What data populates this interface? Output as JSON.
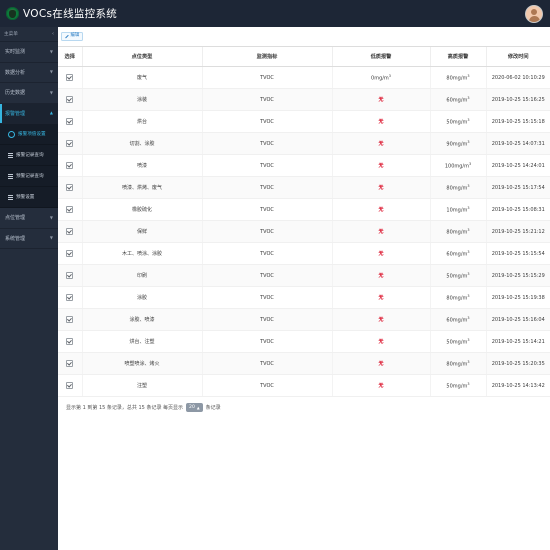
{
  "header": {
    "title": "VOCs在线监控系统",
    "logo_icon": "leaf-logo-icon",
    "avatar_icon": "user-avatar-icon"
  },
  "sidebar": {
    "menu_label": "主菜单",
    "collapse_icon": "chevron-left-icon",
    "items": [
      {
        "label": "实时监测",
        "icon": "chevron-down-icon",
        "active": false
      },
      {
        "label": "数据分析",
        "icon": "chevron-down-icon",
        "active": false
      },
      {
        "label": "历史数据",
        "icon": "chevron-down-icon",
        "active": false
      },
      {
        "label": "报警管理",
        "icon": "chevron-up-icon",
        "active": true
      }
    ],
    "sub_items": [
      {
        "label": "报警项值设置",
        "icon": "gear-icon",
        "active": true
      },
      {
        "label": "报警记录查询",
        "icon": "list-icon",
        "active": false
      },
      {
        "label": "预警记录查询",
        "icon": "list-icon",
        "active": false
      },
      {
        "label": "预警设置",
        "icon": "list-icon",
        "active": false
      }
    ],
    "items_bottom": [
      {
        "label": "点位管理",
        "icon": "chevron-down-icon",
        "active": false
      },
      {
        "label": "系统管理",
        "icon": "chevron-down-icon",
        "active": false
      }
    ]
  },
  "toolbar": {
    "edit_label": "编辑",
    "edit_icon": "pencil-icon"
  },
  "table": {
    "columns": [
      "选择",
      "点位类型",
      "监测指标",
      "低质报警",
      "高质报警",
      "修改时间"
    ],
    "rows": [
      {
        "checked": true,
        "type": "废气",
        "metric": "TVOC",
        "low": "0mg/m³",
        "low_none": false,
        "high": "80mg/m³",
        "time": "2020-06-02 10:10:29"
      },
      {
        "checked": true,
        "type": "涂装",
        "metric": "TVOC",
        "low": "无",
        "low_none": true,
        "high": "60mg/m³",
        "time": "2019-10-25 15:16:25"
      },
      {
        "checked": true,
        "type": "烘台",
        "metric": "TVOC",
        "low": "无",
        "low_none": true,
        "high": "50mg/m³",
        "time": "2019-10-25 15:15:18"
      },
      {
        "checked": true,
        "type": "切割、涂胶",
        "metric": "TVOC",
        "low": "无",
        "low_none": true,
        "high": "90mg/m³",
        "time": "2019-10-25 14:07:31"
      },
      {
        "checked": true,
        "type": "喷漆",
        "metric": "TVOC",
        "low": "无",
        "low_none": true,
        "high": "100mg/m³",
        "time": "2019-10-25 14:24:01"
      },
      {
        "checked": true,
        "type": "喷漆、烘烤、废气",
        "metric": "TVOC",
        "low": "无",
        "low_none": true,
        "high": "80mg/m³",
        "time": "2019-10-25 15:17:54"
      },
      {
        "checked": true,
        "type": "橡胶硫化",
        "metric": "TVOC",
        "low": "无",
        "low_none": true,
        "high": "10mg/m³",
        "time": "2019-10-25 15:08:31"
      },
      {
        "checked": true,
        "type": "保鲜",
        "metric": "TVOC",
        "low": "无",
        "low_none": true,
        "high": "80mg/m³",
        "time": "2019-10-25 15:21:12"
      },
      {
        "checked": true,
        "type": "木工、喷涂、涂胶",
        "metric": "TVOC",
        "low": "无",
        "low_none": true,
        "high": "60mg/m³",
        "time": "2019-10-25 15:15:54"
      },
      {
        "checked": true,
        "type": "印刷",
        "metric": "TVOC",
        "low": "无",
        "low_none": true,
        "high": "50mg/m³",
        "time": "2019-10-25 15:15:29"
      },
      {
        "checked": true,
        "type": "涂胶",
        "metric": "TVOC",
        "low": "无",
        "low_none": true,
        "high": "80mg/m³",
        "time": "2019-10-25 15:19:38"
      },
      {
        "checked": true,
        "type": "涂胶、喷漆",
        "metric": "TVOC",
        "low": "无",
        "low_none": true,
        "high": "60mg/m³",
        "time": "2019-10-25 15:16:04"
      },
      {
        "checked": true,
        "type": "烘台、注塑",
        "metric": "TVOC",
        "low": "无",
        "low_none": true,
        "high": "50mg/m³",
        "time": "2019-10-25 15:14:21"
      },
      {
        "checked": true,
        "type": "喷塑喷涂、烤火",
        "metric": "TVOC",
        "low": "无",
        "low_none": true,
        "high": "80mg/m³",
        "time": "2019-10-25 15:20:35"
      },
      {
        "checked": true,
        "type": "注塑",
        "metric": "TVOC",
        "low": "无",
        "low_none": true,
        "high": "50mg/m³",
        "time": "2019-10-25 14:13:42"
      }
    ]
  },
  "footer": {
    "summary": "显示第 1 到第 15 条记录，总共 15 条记录 每页显示",
    "page_size": "20",
    "caret_icon": "caret-up-icon",
    "suffix": "条记录"
  }
}
